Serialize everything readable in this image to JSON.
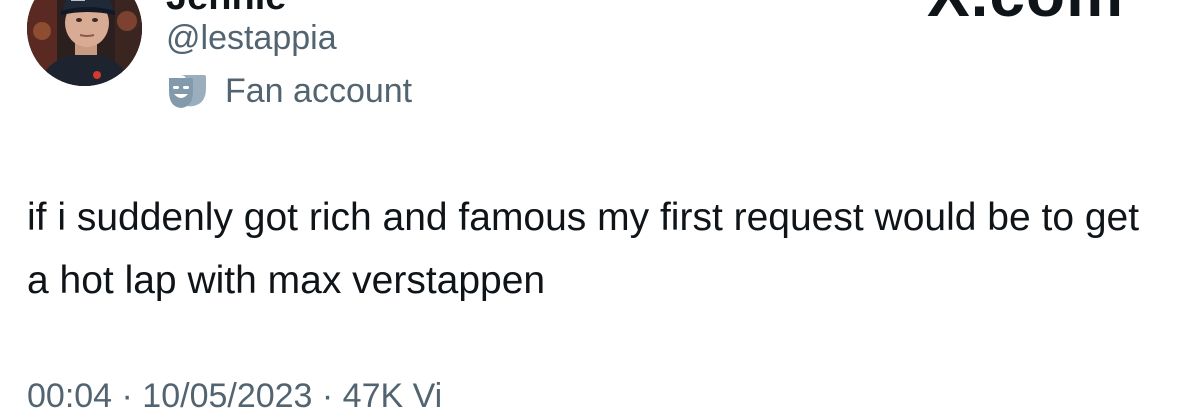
{
  "tweet": {
    "author": {
      "display_name": "Jennie",
      "handle": "@lestappia",
      "label_text": "Fan account",
      "label_icon": "drama-masks-icon"
    },
    "watermark": "X.com",
    "text": "if i suddenly got rich and famous my first request would be to get a hot lap with max verstappen",
    "meta_partial": "00:04 · 10/05/2023 · 47K Vi"
  },
  "colors": {
    "primary_text": "#0f1419",
    "secondary_text": "#536471",
    "label_icon": "#829aab",
    "background": "#ffffff"
  }
}
